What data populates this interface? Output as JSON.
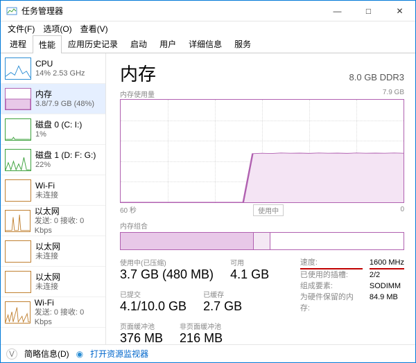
{
  "window": {
    "title": "任务管理器",
    "minimize": "—",
    "maximize": "□",
    "close": "✕"
  },
  "menu": {
    "file": "文件(F)",
    "options": "选项(O)",
    "view": "查看(V)"
  },
  "tabs": {
    "processes": "进程",
    "performance": "性能",
    "history": "应用历史记录",
    "startup": "启动",
    "users": "用户",
    "details": "详细信息",
    "services": "服务"
  },
  "sidebar": [
    {
      "title": "CPU",
      "sub": "14% 2.53 GHz",
      "color": "#2a8dd4",
      "kind": "cpu"
    },
    {
      "title": "内存",
      "sub": "3.8/7.9 GB (48%)",
      "color": "#b060b0",
      "kind": "mem",
      "selected": true
    },
    {
      "title": "磁盘 0 (C: I:)",
      "sub": "1%",
      "color": "#3aa03a",
      "kind": "disk"
    },
    {
      "title": "磁盘 1 (D: F: G:)",
      "sub": "22%",
      "color": "#3aa03a",
      "kind": "disk2"
    },
    {
      "title": "Wi-Fi",
      "sub": "未连接",
      "color": "#c08030",
      "kind": "wifi"
    },
    {
      "title": "以太网",
      "sub": "发送: 0 接收: 0 Kbps",
      "color": "#c08030",
      "kind": "eth"
    },
    {
      "title": "以太网",
      "sub": "未连接",
      "color": "#c08030",
      "kind": "eth2"
    },
    {
      "title": "以太网",
      "sub": "未连接",
      "color": "#c08030",
      "kind": "eth3"
    },
    {
      "title": "Wi-Fi",
      "sub": "发送: 0 接收: 0 Kbps",
      "color": "#c08030",
      "kind": "wifi2"
    }
  ],
  "main": {
    "title": "内存",
    "spec": "8.0 GB DDR3",
    "chart_top_label": "内存使用量",
    "chart_top_right": "7.9 GB",
    "chart_bottom_left": "60 秒",
    "chart_bottom_right": "0",
    "usage_badge": "使用中",
    "comp_label": "内存组合"
  },
  "stats": {
    "used_label": "使用中(已压缩)",
    "used_value": "3.7 GB (480 MB)",
    "avail_label": "可用",
    "avail_value": "4.1 GB",
    "commit_label": "已提交",
    "commit_value": "4.1/10.0 GB",
    "cached_label": "已缓存",
    "cached_value": "2.7 GB",
    "paged_label": "页面缓冲池",
    "paged_value": "376 MB",
    "nonpaged_label": "非页面缓冲池",
    "nonpaged_value": "216 MB"
  },
  "meta": {
    "speed_k": "速度:",
    "speed_v": "1600 MHz",
    "slots_k": "已使用的插槽:",
    "slots_v": "2/2",
    "form_k": "组成要素:",
    "form_v": "SODIMM",
    "hw_k": "为硬件保留的内存:",
    "hw_v": "84.9 MB"
  },
  "footer": {
    "brief": "简略信息(D)",
    "monitor": "打开资源监视器"
  },
  "chart_data": {
    "type": "area",
    "title": "内存使用量",
    "ylabel": "GB",
    "ylim": [
      0,
      7.9
    ],
    "xlabel": "秒",
    "xlim": [
      60,
      0
    ],
    "series": [
      {
        "name": "内存",
        "x": [
          60,
          58,
          56,
          54,
          52,
          50,
          48,
          46,
          44,
          42,
          40,
          38,
          36,
          34,
          32,
          30,
          28,
          26,
          24,
          22,
          20,
          18,
          16,
          14,
          12,
          10,
          8,
          6,
          4,
          2,
          0
        ],
        "values": [
          0,
          0,
          0,
          0,
          0,
          0,
          0,
          0,
          0,
          0,
          0,
          0,
          0,
          0,
          3.75,
          3.78,
          3.76,
          3.8,
          3.78,
          3.79,
          3.77,
          3.8,
          3.78,
          3.79,
          3.77,
          3.8,
          3.78,
          3.79,
          3.78,
          3.8,
          3.78
        ]
      }
    ]
  }
}
